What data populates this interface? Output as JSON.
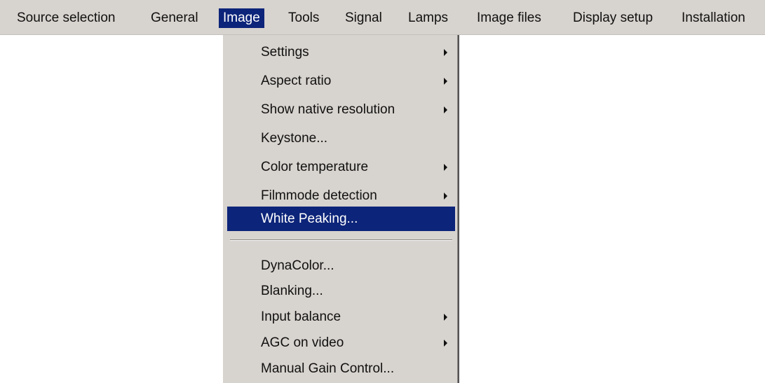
{
  "menubar": {
    "items": [
      {
        "label": "Source selection"
      },
      {
        "label": "General"
      },
      {
        "label": "Image"
      },
      {
        "label": "Tools"
      },
      {
        "label": "Signal"
      },
      {
        "label": "Lamps"
      },
      {
        "label": "Image files"
      },
      {
        "label": "Display setup"
      },
      {
        "label": "Installation"
      }
    ],
    "active": "Image"
  },
  "image_menu": {
    "items": [
      {
        "label": "Settings",
        "has_submenu": true
      },
      {
        "label": "Aspect ratio",
        "has_submenu": true
      },
      {
        "label": "Show native resolution",
        "has_submenu": true
      },
      {
        "label": "Keystone...",
        "has_submenu": false
      },
      {
        "label": "Color temperature",
        "has_submenu": true
      },
      {
        "label": "Filmmode detection",
        "has_submenu": true
      },
      {
        "label": "White Peaking...",
        "has_submenu": false
      },
      {
        "label": "DynaColor...",
        "has_submenu": false
      },
      {
        "label": "Blanking...",
        "has_submenu": false
      },
      {
        "label": "Input balance",
        "has_submenu": true
      },
      {
        "label": "AGC on video",
        "has_submenu": true
      },
      {
        "label": "Manual Gain Control...",
        "has_submenu": false
      }
    ],
    "highlighted": "White Peaking..."
  },
  "colors": {
    "menu_background": "#d7d3ce",
    "highlight": "#0c2479",
    "highlight_text": "#ffffff",
    "text": "#111111"
  }
}
